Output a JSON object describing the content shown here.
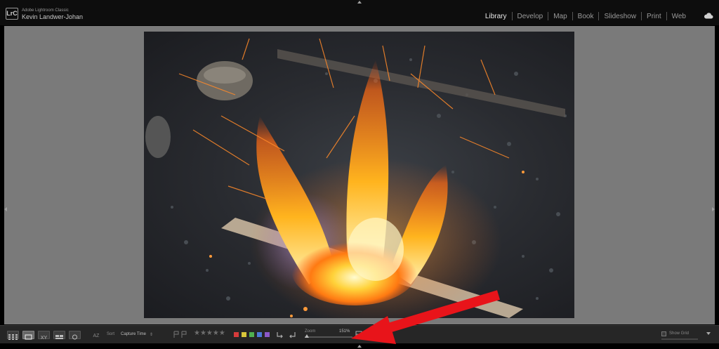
{
  "app": {
    "logo_text": "LrC",
    "name": "Adobe Lightroom Classic",
    "user": "Kevin Landwer-Johan"
  },
  "modules": [
    {
      "label": "Library",
      "active": true
    },
    {
      "label": "Develop",
      "active": false
    },
    {
      "label": "Map",
      "active": false
    },
    {
      "label": "Book",
      "active": false
    },
    {
      "label": "Slideshow",
      "active": false
    },
    {
      "label": "Print",
      "active": false
    },
    {
      "label": "Web",
      "active": false
    }
  ],
  "toolbar": {
    "sort_label": "Sort",
    "sort_value": "Capture Time",
    "rating_stars": "★★★★★",
    "color_labels": [
      "#d63b3b",
      "#d8c63a",
      "#4fb04f",
      "#4a78d6",
      "#8b58c8"
    ],
    "zoom_label": "Zoom",
    "zoom_value": "151%",
    "zoom_level": 0.05,
    "show_grid_label": "Show Grid"
  },
  "icons": {
    "cloud": "cloud-icon",
    "grid": "grid-view-icon",
    "loupe": "loupe-view-icon",
    "compare": "compare-view-icon",
    "survey": "survey-view-icon",
    "people": "people-view-icon"
  },
  "colors": {
    "background": "#7a7a7a",
    "toolbar": "#262626",
    "annotation_arrow": "#e8141a"
  }
}
